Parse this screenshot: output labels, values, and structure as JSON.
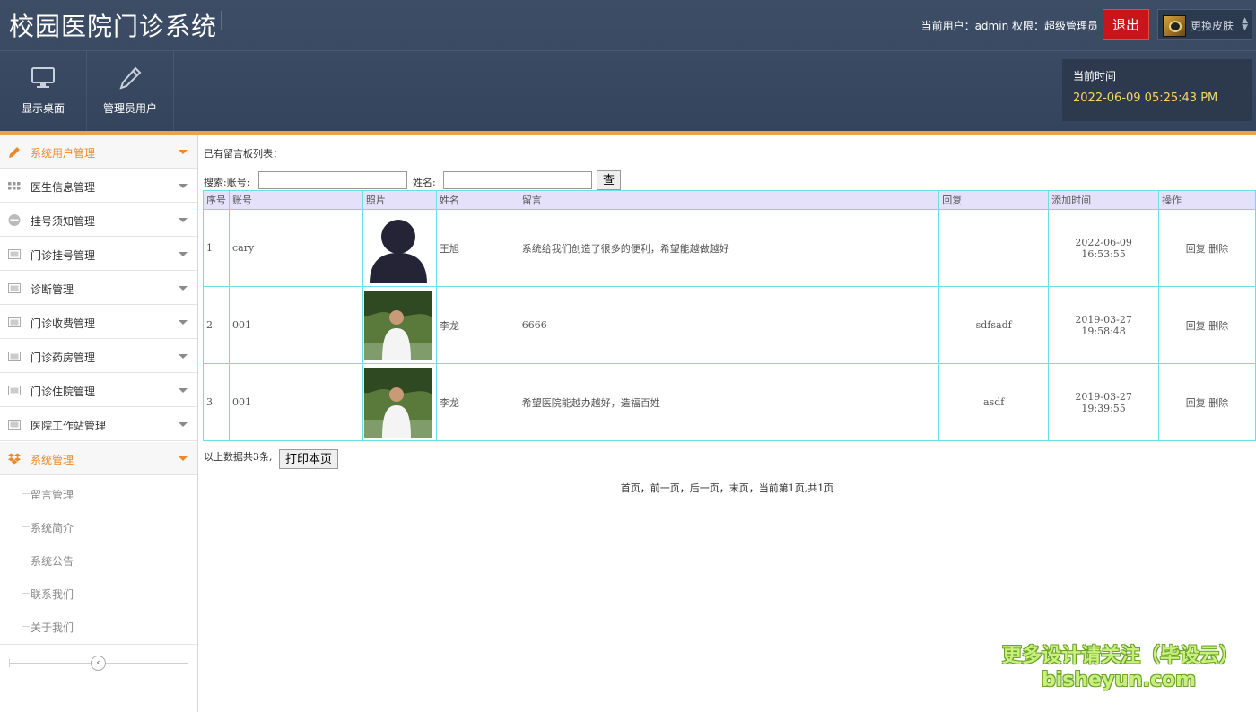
{
  "header": {
    "title": "校园医院门诊系统",
    "user_label": "当前用户：admin 权限：超级管理员",
    "logout_label": "退出",
    "skin_label": "更换皮肤"
  },
  "toolbar": {
    "items": [
      {
        "label": "显示桌面",
        "icon": "monitor-icon"
      },
      {
        "label": "管理员用户",
        "icon": "pencil-icon"
      }
    ]
  },
  "time_panel": {
    "label": "当前时间",
    "value": "2022-06-09 05:25:43 PM"
  },
  "sidebar": {
    "items": [
      {
        "label": "系统用户管理",
        "icon": "pencil-icon"
      },
      {
        "label": "医生信息管理",
        "icon": "grid-icon"
      },
      {
        "label": "挂号须知管理",
        "icon": "minus-circle-icon"
      },
      {
        "label": "门诊挂号管理",
        "icon": "image-icon"
      },
      {
        "label": "诊断管理",
        "icon": "image-icon"
      },
      {
        "label": "门诊收费管理",
        "icon": "image-icon"
      },
      {
        "label": "门诊药房管理",
        "icon": "image-icon"
      },
      {
        "label": "门诊住院管理",
        "icon": "image-icon"
      },
      {
        "label": "医院工作站管理",
        "icon": "image-icon"
      },
      {
        "label": "系统管理",
        "icon": "dropbox-icon"
      }
    ],
    "sub_items": [
      {
        "label": "留言管理"
      },
      {
        "label": "系统简介"
      },
      {
        "label": "系统公告"
      },
      {
        "label": "联系我们"
      },
      {
        "label": "关于我们"
      }
    ]
  },
  "main": {
    "heading": "已有留言板列表：",
    "search": {
      "account_label": "搜索:账号:",
      "name_label": "姓名:",
      "account_value": "",
      "name_value": "",
      "button_label": "查找"
    },
    "table": {
      "headers": [
        "序号",
        "账号",
        "照片",
        "姓名",
        "留言",
        "回复",
        "添加时间",
        "操作"
      ],
      "rows": [
        {
          "no": "1",
          "account": "cary",
          "photo": "avatar-placeholder",
          "name": "王旭",
          "message": "系统给我们创造了很多的便利，希望能越做越好",
          "reply": "",
          "time": "2022-06-09 16:53:55",
          "reply_action": "回复",
          "delete_action": "删除"
        },
        {
          "no": "2",
          "account": "001",
          "photo": "person-photo",
          "name": "李龙",
          "message": "6666",
          "reply": "sdfsadf",
          "time": "2019-03-27 19:58:48",
          "reply_action": "回复",
          "delete_action": "删除"
        },
        {
          "no": "3",
          "account": "001",
          "photo": "person-photo",
          "name": "李龙",
          "message": "希望医院能越办越好，造福百姓",
          "reply": "asdf",
          "time": "2019-03-27 19:39:55",
          "reply_action": "回复",
          "delete_action": "删除"
        }
      ]
    },
    "summary": "以上数据共3条,",
    "print_label": "打印本页",
    "pager": "首页，前一页，后一页，末页，当前第1页,共1页"
  },
  "watermark": {
    "line1": "更多设计请关注（毕设云）",
    "line2": "bisheyun.com"
  }
}
